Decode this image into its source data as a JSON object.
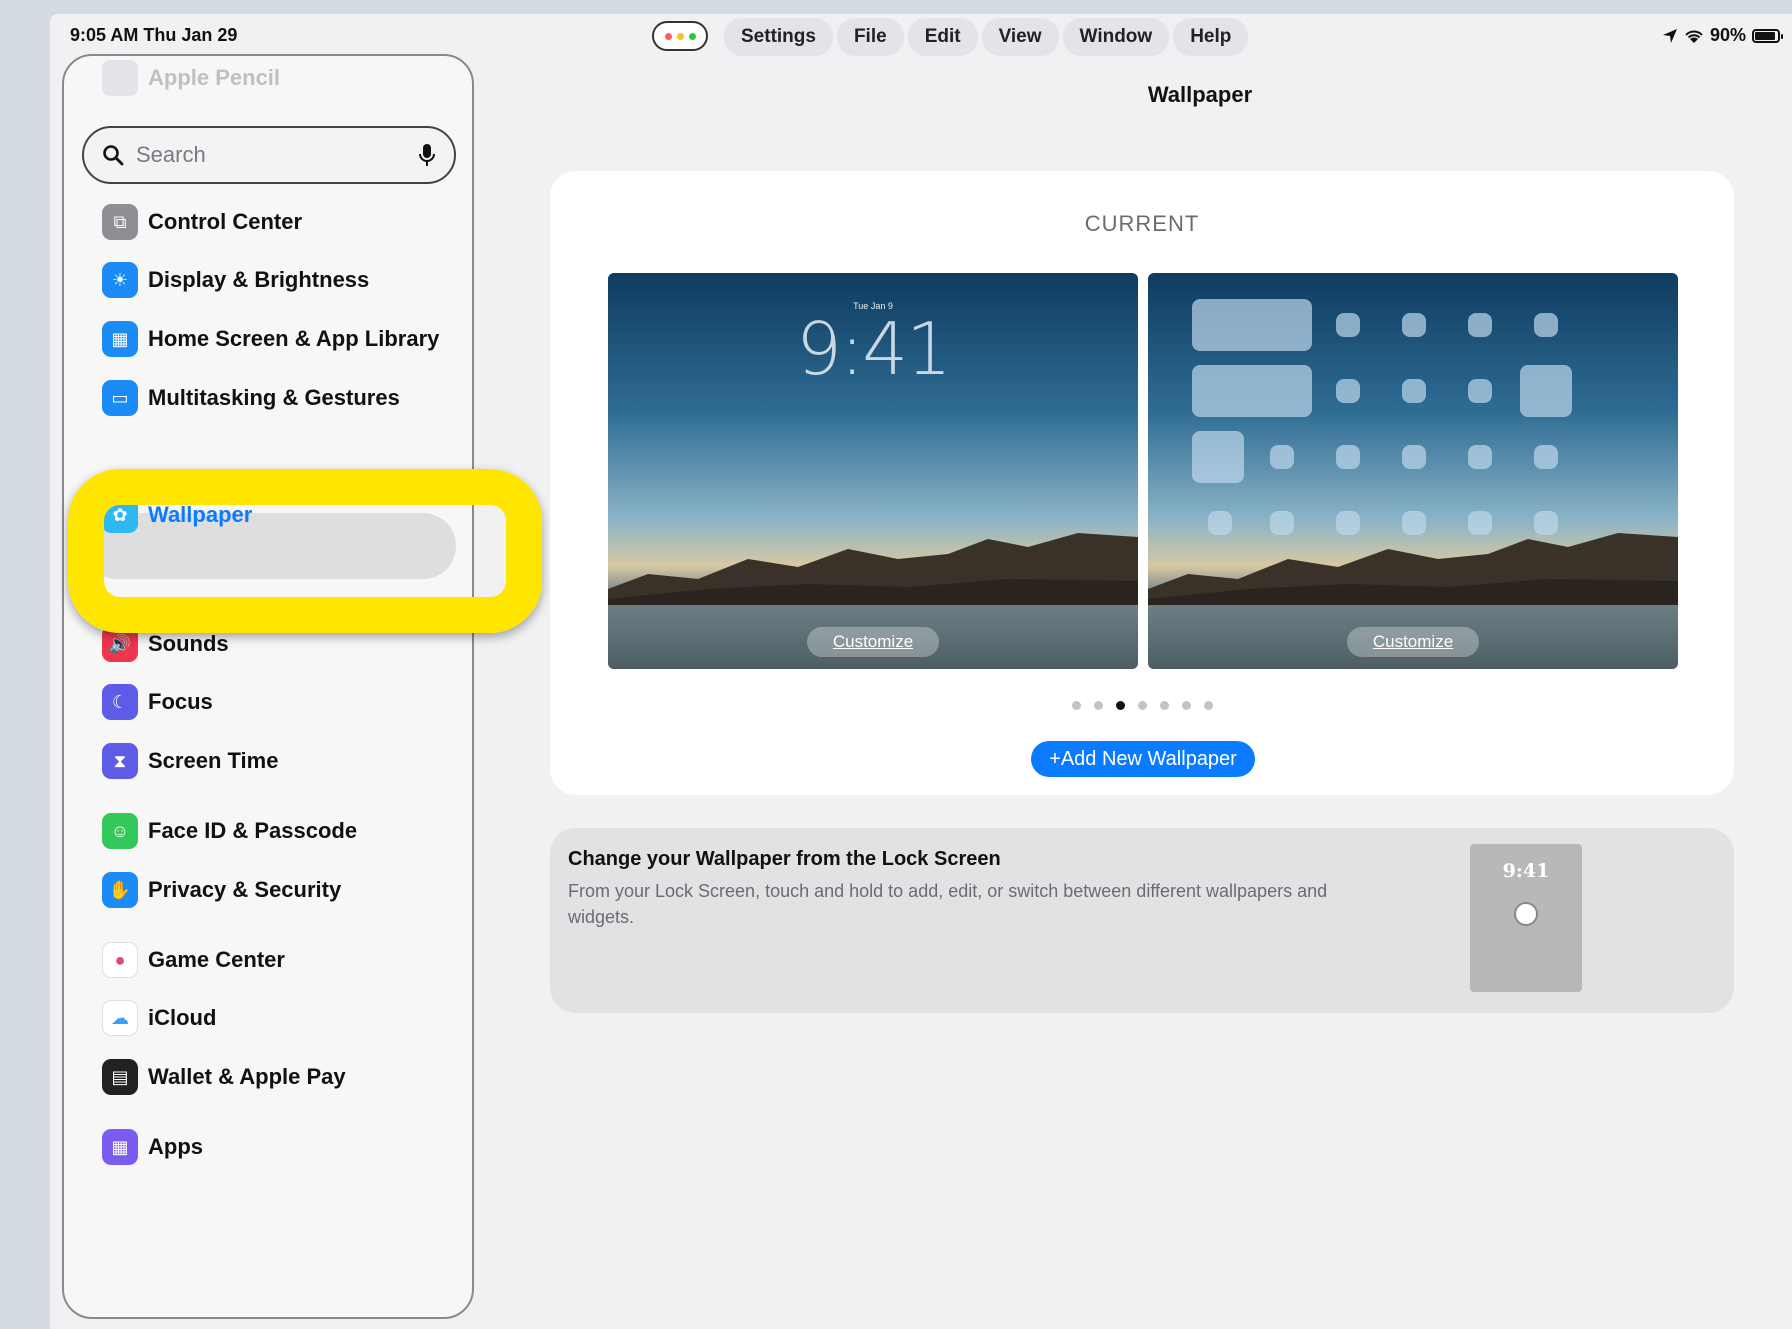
{
  "status": {
    "time": "9:05 AM   Thu Jan 29",
    "battery": "90%",
    "battery_level": 0.9
  },
  "menubar": [
    "Settings",
    "File",
    "Edit",
    "View",
    "Window",
    "Help"
  ],
  "window_dots_colors": [
    "#ff5f57",
    "#febc2e",
    "#28c840"
  ],
  "page_title": "Wallpaper",
  "sidebar": {
    "faded_top": "Apple Pencil",
    "search_placeholder": "Search",
    "items": [
      {
        "label": "Control Center",
        "icon": "switches-icon",
        "color": "#8e8e93"
      },
      {
        "label": "Display & Brightness",
        "icon": "sun-icon",
        "color": "#1b8cf5"
      },
      {
        "label": "Home Screen & App Library",
        "icon": "home-screen-icon",
        "color": "#1b8cf5"
      },
      {
        "label": "Multitasking & Gestures",
        "icon": "multitasking-icon",
        "color": "#1b8cf5"
      },
      {
        "label": "Wallpaper",
        "icon": "flower-icon",
        "color": "#2fb7f0",
        "selected": true
      },
      {
        "label": "Sounds",
        "icon": "speaker-icon",
        "color": "#f0364c"
      },
      {
        "label": "Focus",
        "icon": "moon-icon",
        "color": "#5e5ce6"
      },
      {
        "label": "Screen Time",
        "icon": "hourglass-icon",
        "color": "#5e5ce6"
      },
      {
        "label": "Face ID & Passcode",
        "icon": "face-id-icon",
        "color": "#34c759"
      },
      {
        "label": "Privacy & Security",
        "icon": "hand-icon",
        "color": "#1b8cf5"
      },
      {
        "label": "Game Center",
        "icon": "game-center-icon",
        "color": "#ffffff"
      },
      {
        "label": "iCloud",
        "icon": "cloud-icon",
        "color": "#ffffff"
      },
      {
        "label": "Wallet & Apple Pay",
        "icon": "wallet-icon",
        "color": "#222222"
      },
      {
        "label": "Apps",
        "icon": "apps-grid-icon",
        "color": "#7b5cf0"
      }
    ]
  },
  "current": {
    "label": "CURRENT",
    "lock_date": "Tue Jan 9",
    "lock_time": "9:41",
    "customize_label": "Customize",
    "page_count": 7,
    "active_page": 3,
    "add_button": "+Add New Wallpaper"
  },
  "tip": {
    "title": "Change your Wallpaper from the Lock Screen",
    "description": "From your Lock Screen, touch and hold to add, edit, or switch between different wallpapers and widgets.",
    "phone_time": "9:41"
  },
  "colors": {
    "accent": "#0a7aff",
    "highlight": "#ffe600"
  }
}
